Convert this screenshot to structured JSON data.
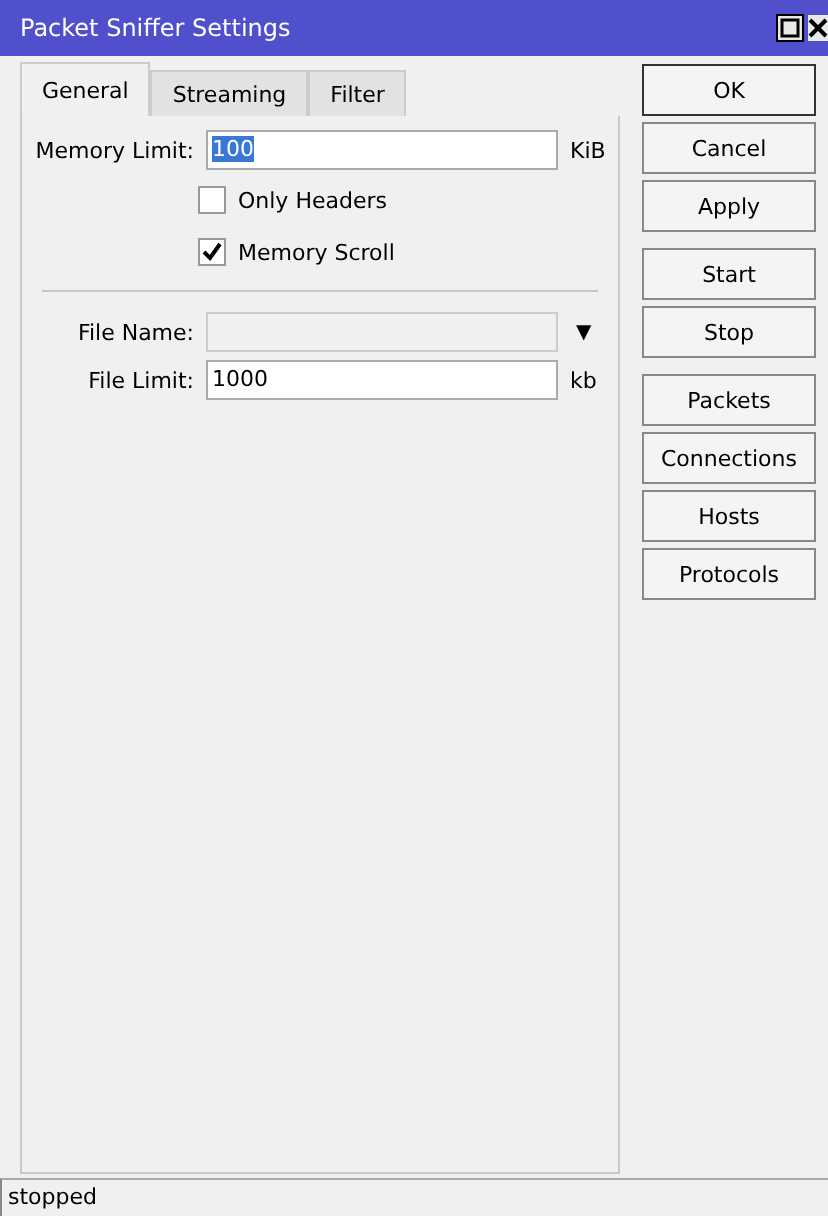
{
  "window": {
    "title": "Packet Sniffer Settings"
  },
  "tabs": [
    {
      "label": "General",
      "selected": true
    },
    {
      "label": "Streaming",
      "selected": false
    },
    {
      "label": "Filter",
      "selected": false
    }
  ],
  "memory_limit": {
    "label": "Memory Limit:",
    "value": "100",
    "highlighted": true,
    "unit": "KiB"
  },
  "checkboxes": [
    {
      "label": "Only Headers",
      "checked": false
    },
    {
      "label": "Memory Scroll",
      "checked": true
    }
  ],
  "file_name": {
    "label": "File Name:",
    "disabled": true,
    "dropdown": "▼"
  },
  "file_limit": {
    "label": "File Limit:",
    "value": "1000",
    "unit": "kb"
  },
  "button_groups": [
    [
      "OK",
      "Cancel",
      "Apply"
    ],
    [
      "Start",
      "Stop"
    ],
    [
      "Packets",
      "Connections",
      "Hosts",
      "Protocols"
    ]
  ],
  "status_bar": "stopped"
}
